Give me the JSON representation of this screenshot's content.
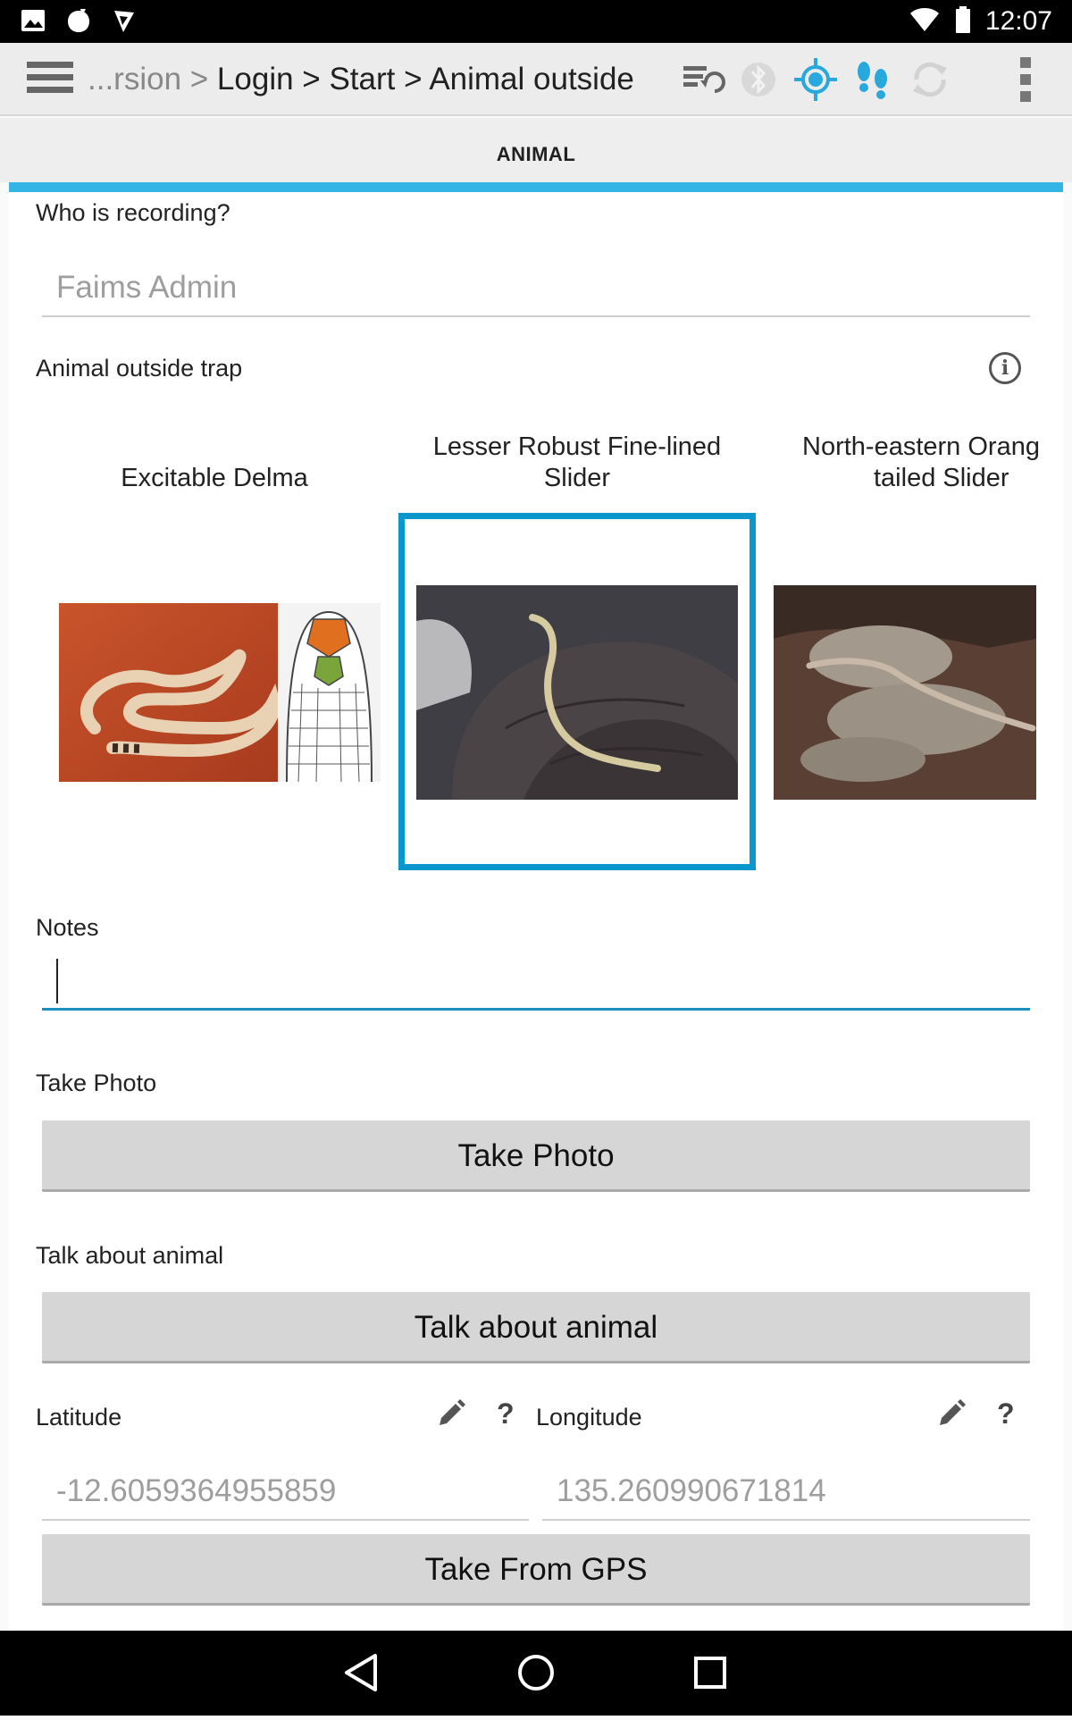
{
  "status_bar": {
    "time": "12:07"
  },
  "action_bar": {
    "breadcrumb_prefix": "...rsion > ",
    "breadcrumb_path": "Login > Start > Animal outside"
  },
  "tab": {
    "label": "ANIMAL"
  },
  "form": {
    "recorder": {
      "label": "Who is recording?",
      "value": "Faims Admin"
    },
    "animal_outside_trap": {
      "label": "Animal outside trap",
      "options": [
        {
          "name": "Excitable Delma",
          "selected": false
        },
        {
          "name_line1": "Lesser Robust Fine-lined",
          "name_line2": "Slider",
          "selected": true
        },
        {
          "name_line1": "North-eastern Orang",
          "name_line2": "tailed Slider",
          "selected": false
        }
      ]
    },
    "notes": {
      "label": "Notes",
      "value": ""
    },
    "take_photo": {
      "label": "Take Photo",
      "button": "Take Photo"
    },
    "talk_about_animal": {
      "label": "Talk about animal",
      "button": "Talk about animal"
    },
    "latitude": {
      "label": "Latitude",
      "value": "-12.6059364955859",
      "help": "?"
    },
    "longitude": {
      "label": "Longitude",
      "value": "135.260990671814",
      "help": "?"
    },
    "gps_button": "Take From GPS"
  },
  "colors": {
    "accent": "#33b5e5",
    "selected_border": "#0b96cc"
  }
}
